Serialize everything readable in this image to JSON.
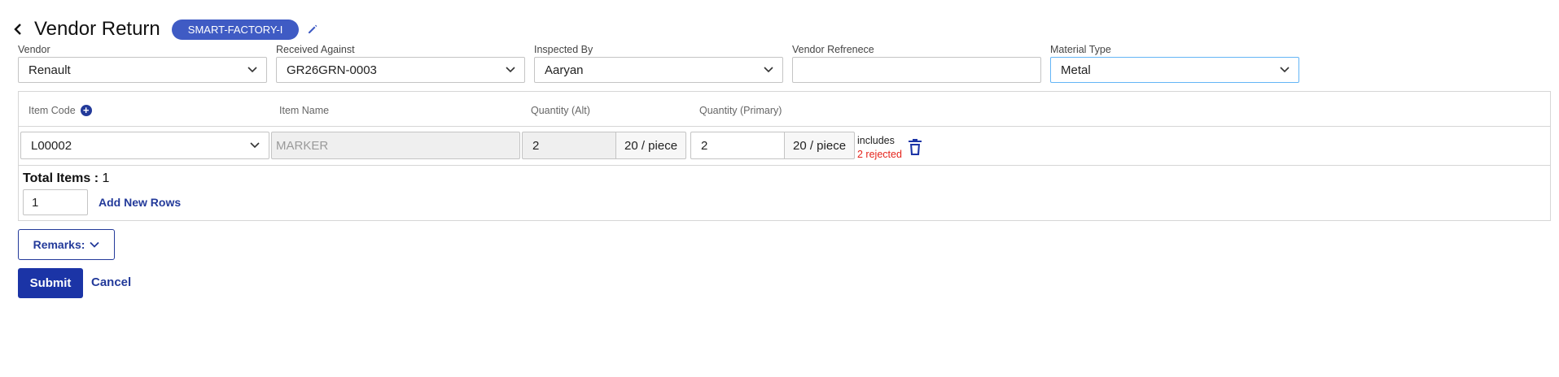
{
  "header": {
    "title": "Vendor Return",
    "badge": "SMART-FACTORY-I",
    "back_icon": "chevron-left-icon",
    "edit_icon": "pencil-icon"
  },
  "form": {
    "vendor": {
      "label": "Vendor",
      "value": "Renault"
    },
    "received_against": {
      "label": "Received Against",
      "value": "GR26GRN-0003"
    },
    "inspected_by": {
      "label": "Inspected By",
      "value": "Aaryan"
    },
    "vendor_reference": {
      "label": "Vendor Refrenece",
      "value": ""
    },
    "material_type": {
      "label": "Material Type",
      "value": "Metal"
    }
  },
  "items": {
    "columns": {
      "item_code": "Item Code",
      "item_name": "Item Name",
      "qty_alt": "Quantity (Alt)",
      "qty_primary": "Quantity (Primary)"
    },
    "rows": [
      {
        "item_code": "L00002",
        "item_name": "MARKER",
        "qty_alt": "2",
        "qty_alt_unit": "20 / piece",
        "qty_primary": "2",
        "qty_primary_unit": "20 / piece",
        "includes": "includes",
        "rejected": "2 rejected"
      }
    ],
    "total_label": "Total Items :",
    "total_value": "1",
    "new_rows_value": "1",
    "add_rows_label": "Add New Rows"
  },
  "actions": {
    "remarks_label": "Remarks:",
    "submit_label": "Submit",
    "cancel_label": "Cancel"
  },
  "colors": {
    "primary": "#1b34a6",
    "badge": "#3f5bc4",
    "reject": "#e5241c",
    "focus": "#64b5f6"
  }
}
